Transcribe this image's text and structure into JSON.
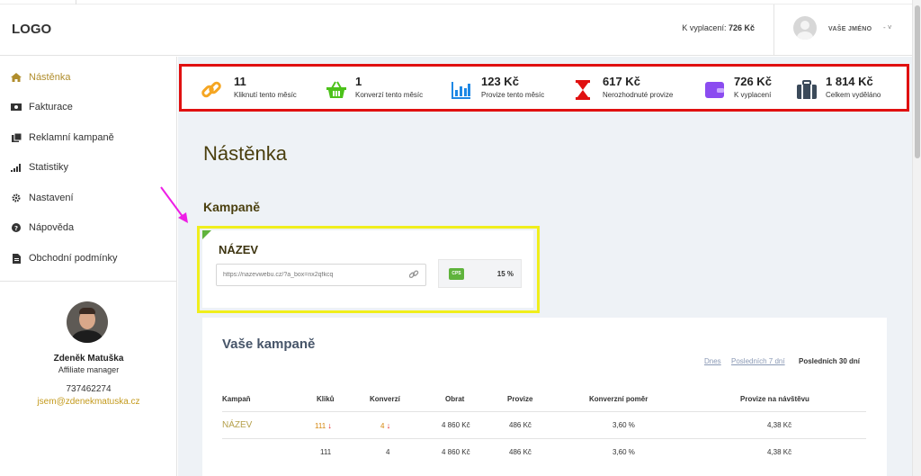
{
  "header": {
    "logo": "LOGO",
    "payout_label": "K vyplacení:",
    "payout_value": "726 Kč",
    "user_name": "VAŠE JMÉNO",
    "user_caret": "-  ˅"
  },
  "sidebar": {
    "items": [
      {
        "label": "Nástěnka",
        "icon": "home-icon",
        "active": true
      },
      {
        "label": "Fakturace",
        "icon": "money-icon",
        "active": false
      },
      {
        "label": "Reklamní kampaně",
        "icon": "documents-icon",
        "active": false
      },
      {
        "label": "Statistiky",
        "icon": "bar-chart-icon",
        "active": false
      },
      {
        "label": "Nastavení",
        "icon": "gear-icon",
        "active": false
      },
      {
        "label": "Nápověda",
        "icon": "help-icon",
        "active": false
      },
      {
        "label": "Obchodní podmínky",
        "icon": "file-icon",
        "active": false
      }
    ],
    "manager": {
      "name": "Zdeněk Matuška",
      "role": "Affiliate manager",
      "phone": "737462274",
      "email": "jsem@zdenekmatuska.cz"
    }
  },
  "stats": [
    {
      "value": "11",
      "label": "Kliknutí tento měsíc",
      "icon": "link-icon",
      "color": "#f5a623"
    },
    {
      "value": "1",
      "label": "Konverzí tento měsíc",
      "icon": "basket-icon",
      "color": "#4cc21a"
    },
    {
      "value": "123 Kč",
      "label": "Provize tento měsíc",
      "icon": "bar-chart-icon",
      "color": "#1e88e5"
    },
    {
      "value": "617 Kč",
      "label": "Nerozhodnuté provize",
      "icon": "hourglass-icon",
      "color": "#e01010"
    },
    {
      "value": "726 Kč",
      "label": "K vyplacení",
      "icon": "wallet-icon",
      "color": "#8b4cf0"
    },
    {
      "value": "1 814 Kč",
      "label": "Celkem vyděláno",
      "icon": "briefcase-icon",
      "color": "#3b4a5a"
    }
  ],
  "main": {
    "page_title": "Nástěnka",
    "section_title": "Kampaně",
    "campaign": {
      "name": "NÁZEV",
      "url": "https://nazevwebu.cz/?a_box=nx2qfkcq",
      "badge": "CPS",
      "commission": "15 %"
    },
    "table": {
      "title": "Vaše kampaně",
      "periods": [
        "Dnes",
        "Posledních 7 dní",
        "Posledních 30 dní"
      ],
      "active_period": "Posledních 30 dní",
      "headers": [
        "Kampaň",
        "Kliků",
        "Konverzí",
        "Obrat",
        "Provize",
        "Konverzní poměr",
        "Provize na návštěvu"
      ],
      "rows": [
        {
          "name": "NÁZEV",
          "clicks": "111",
          "conversions": "4",
          "turnover": "4 860 Kč",
          "commission": "486 Kč",
          "ratio": "3,60 %",
          "per_visit": "4,38 Kč",
          "trend_down": true
        },
        {
          "name": "",
          "clicks": "111",
          "conversions": "4",
          "turnover": "4 860 Kč",
          "commission": "486 Kč",
          "ratio": "3,60 %",
          "per_visit": "4,38 Kč",
          "trend_down": false
        }
      ]
    }
  },
  "colors": {
    "accent_gold": "#b08d2c",
    "highlight_red": "#e01010",
    "highlight_yellow": "#f0ee1c",
    "annotation_magenta": "#ee1ee6",
    "cps_green": "#5fb33c"
  }
}
